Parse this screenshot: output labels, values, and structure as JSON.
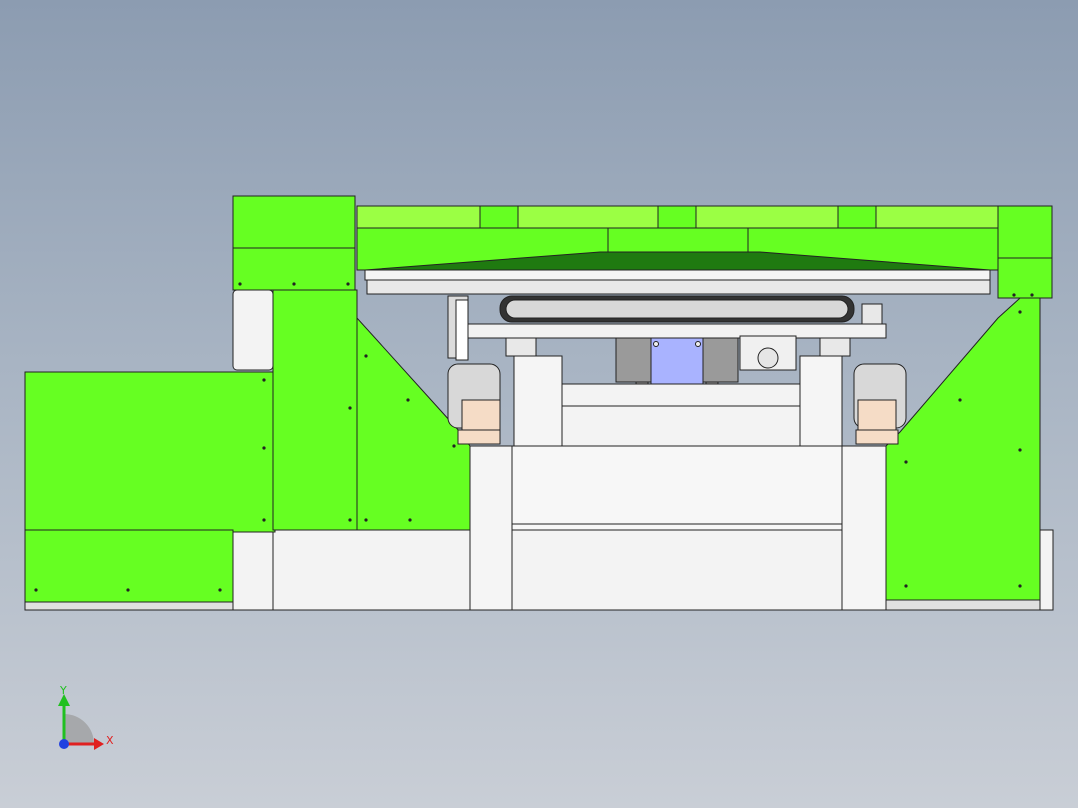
{
  "viewport": {
    "background_top": "#8c9cb1",
    "background_bottom": "#c9ced6"
  },
  "model": {
    "colors": {
      "green_body": "#66ff22",
      "green_light": "#9bff44",
      "green_dark": "#1f7a10",
      "white_part": "#f3f3f3",
      "edge": "#222222",
      "motor_blue": "#a9b3ff",
      "bracket_grey": "#9a9a9a"
    }
  },
  "triad": {
    "x_label": "X",
    "y_label": "Y",
    "x_color": "#e02020",
    "y_color": "#20c020",
    "z_color": "#2040e0"
  }
}
